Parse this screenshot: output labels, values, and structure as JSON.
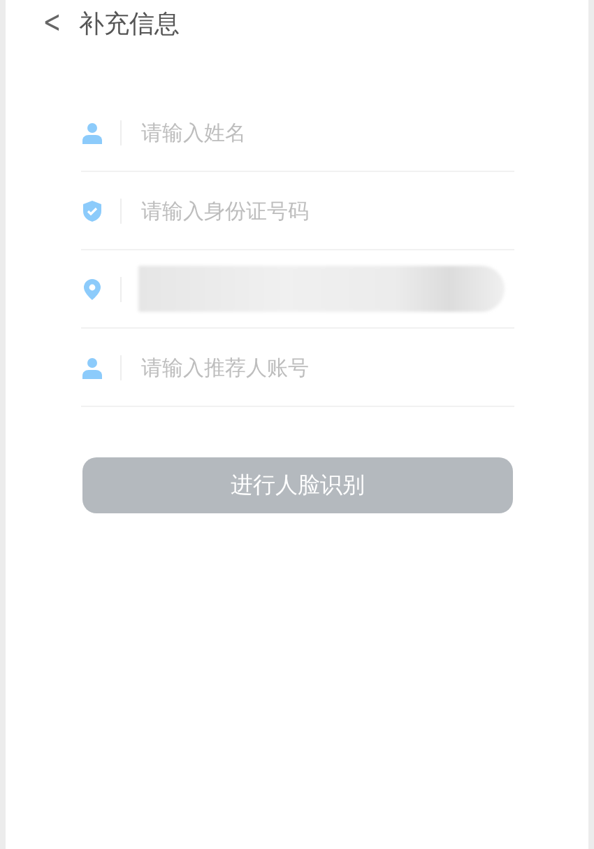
{
  "header": {
    "back": "<",
    "title": "补充信息"
  },
  "fields": [
    {
      "kind": "person",
      "placeholder": "请输入姓名",
      "redacted": false
    },
    {
      "kind": "shield",
      "placeholder": "请输入身份证号码",
      "redacted": false
    },
    {
      "kind": "pin",
      "redacted": true
    },
    {
      "kind": "person",
      "placeholder": "请输入推荐人账号",
      "redacted": false
    }
  ],
  "submit": {
    "label": "进行人脸识别",
    "disabled": true
  }
}
